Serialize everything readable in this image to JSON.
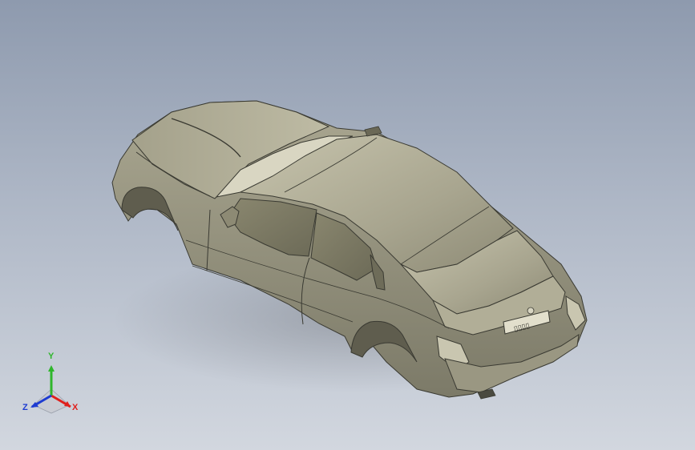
{
  "viewport": {
    "background_top": "#8e9aae",
    "background_bottom": "#d2d7df",
    "model_name": "car-body",
    "model_color": "#a9a690",
    "edge_color": "#3a3a32",
    "plate_text": "▯▯▯▯"
  },
  "triad": {
    "x_label": "X",
    "y_label": "Y",
    "z_label": "Z",
    "x_color": "#e0201c",
    "y_color": "#2fb62c",
    "z_color": "#1d3bd1"
  }
}
